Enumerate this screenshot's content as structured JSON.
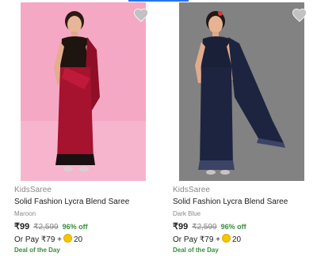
{
  "products": [
    {
      "brand": "KidsSaree",
      "title": "Solid Fashion Lycra Blend Saree",
      "variant": "Maroon",
      "price": "₹99",
      "mrp": "₹2,599",
      "discount": "96% off",
      "pay_prefix": "Or Pay ₹79 +",
      "coin_amount": "20",
      "deal": "Deal of the Day",
      "photo_bg": "#f5a8c4",
      "saree_color": "#a5132e"
    },
    {
      "brand": "KidsSaree",
      "title": "Solid Fashion Lycra Blend Saree",
      "variant": "Dark Blue",
      "price": "₹99",
      "mrp": "₹2,599",
      "discount": "96% off",
      "pay_prefix": "Or Pay ₹79 +",
      "coin_amount": "20",
      "deal": "Deal of the Day",
      "photo_bg": "#7d7d7d",
      "saree_color": "#1d2440"
    }
  ],
  "icons": {
    "wishlist": "heart-icon",
    "coin": "supercoin-icon"
  },
  "colors": {
    "accent": "#2874f0",
    "discount": "#388e3c",
    "muted": "#878787"
  }
}
